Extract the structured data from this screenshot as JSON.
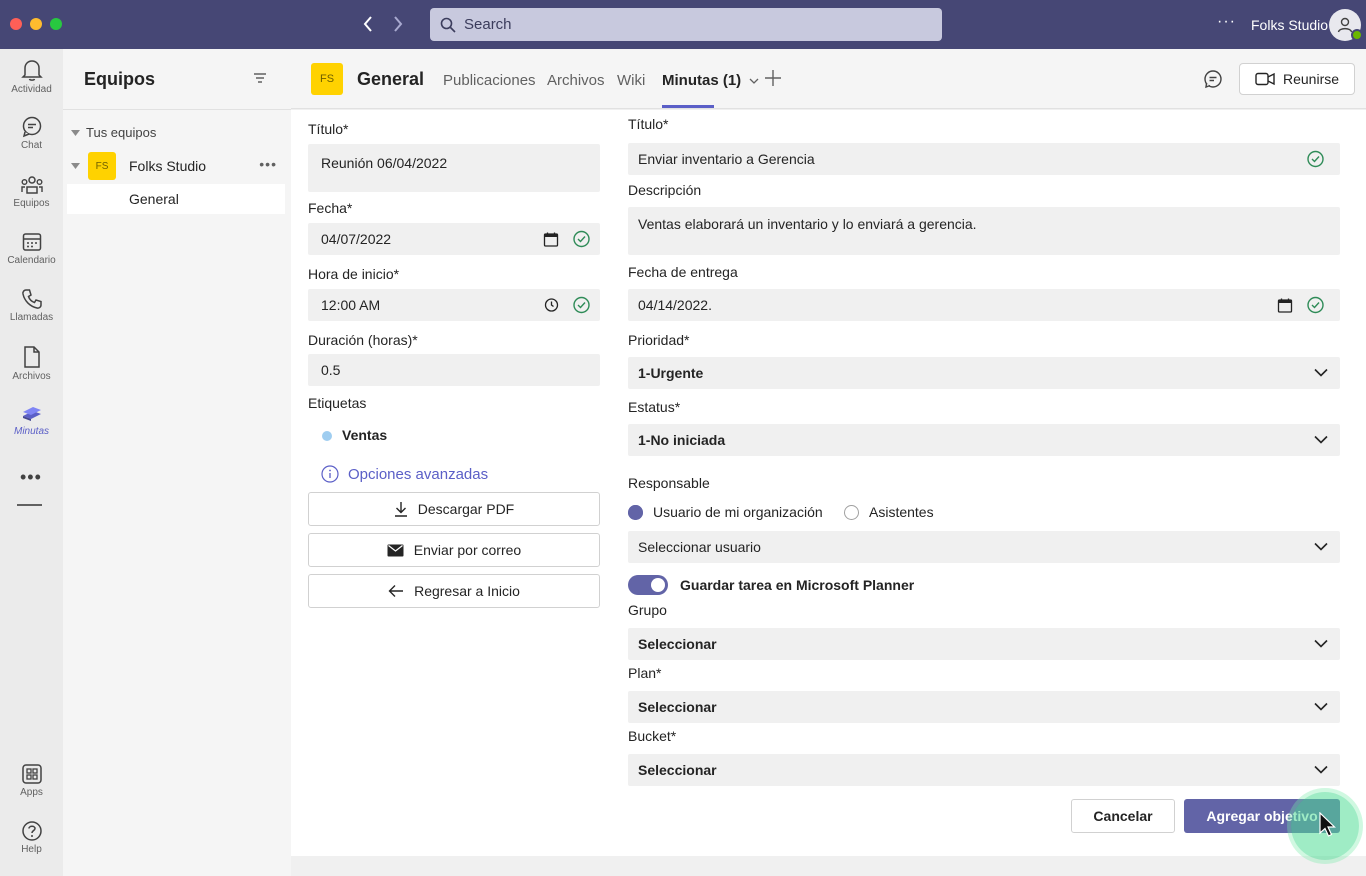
{
  "titlebar": {
    "search_placeholder": "Search",
    "org_name": "Folks Studio",
    "more": "···"
  },
  "rail": [
    {
      "label": "Actividad",
      "icon": "bell-icon"
    },
    {
      "label": "Chat",
      "icon": "chat-icon"
    },
    {
      "label": "Equipos",
      "icon": "teams-icon"
    },
    {
      "label": "Calendario",
      "icon": "calendar-icon"
    },
    {
      "label": "Llamadas",
      "icon": "phone-icon"
    },
    {
      "label": "Archivos",
      "icon": "file-icon"
    },
    {
      "label": "Minutas",
      "icon": "minutas-app-icon",
      "active": true
    },
    {
      "label": "Apps",
      "icon": "apps-icon"
    },
    {
      "label": "Help",
      "icon": "help-icon"
    }
  ],
  "teams_panel": {
    "title": "Equipos",
    "section": "Tus equipos",
    "team": {
      "initials": "FS",
      "name": "Folks Studio"
    },
    "channel": "General"
  },
  "channel_header": {
    "initials": "FS",
    "name": "General",
    "tabs": [
      "Publicaciones",
      "Archivos",
      "Wiki",
      "Minutas (1)"
    ],
    "active_tab": "Minutas (1)",
    "meet_label": "Reunirse"
  },
  "meeting": {
    "title_label": "Título*",
    "title_value": "Reunión 06/04/2022",
    "date_label": "Fecha*",
    "date_value": "04/07/2022",
    "start_label": "Hora de inicio*",
    "start_value": "12:00 AM",
    "duration_label": "Duración (horas)*",
    "duration_value": "0.5",
    "tags_label": "Etiquetas",
    "tag": "Ventas",
    "advanced": "Opciones avanzadas",
    "download_pdf": "Descargar PDF",
    "send_mail": "Enviar por correo",
    "back_home": "Regresar a Inicio"
  },
  "task": {
    "title_label": "Título*",
    "title_value": "Enviar inventario a Gerencia",
    "desc_label": "Descripción",
    "desc_value": "Ventas elaborará un inventario y lo enviará a gerencia.",
    "due_label": "Fecha de entrega",
    "due_value": "04/14/2022.",
    "priority_label": "Prioridad*",
    "priority_value": "1-Urgente",
    "status_label": "Estatus*",
    "status_value": "1-No iniciada",
    "owner_label": "Responsable",
    "owner_opt1": "Usuario de mi organización",
    "owner_opt2": "Asistentes",
    "owner_select": "Seleccionar usuario",
    "planner_toggle": "Guardar tarea en Microsoft Planner",
    "planner_on": true,
    "group_label": "Grupo",
    "group_value": "Seleccionar",
    "plan_label": "Plan*",
    "plan_value": "Seleccionar",
    "bucket_label": "Bucket*",
    "bucket_value": "Seleccionar",
    "cancel": "Cancelar",
    "submit": "Agregar objetivo"
  },
  "colors": {
    "titlebar": "#464775",
    "accent": "#6264a7",
    "team_avatar": "#ffd200",
    "valid": "#2e8b57"
  }
}
